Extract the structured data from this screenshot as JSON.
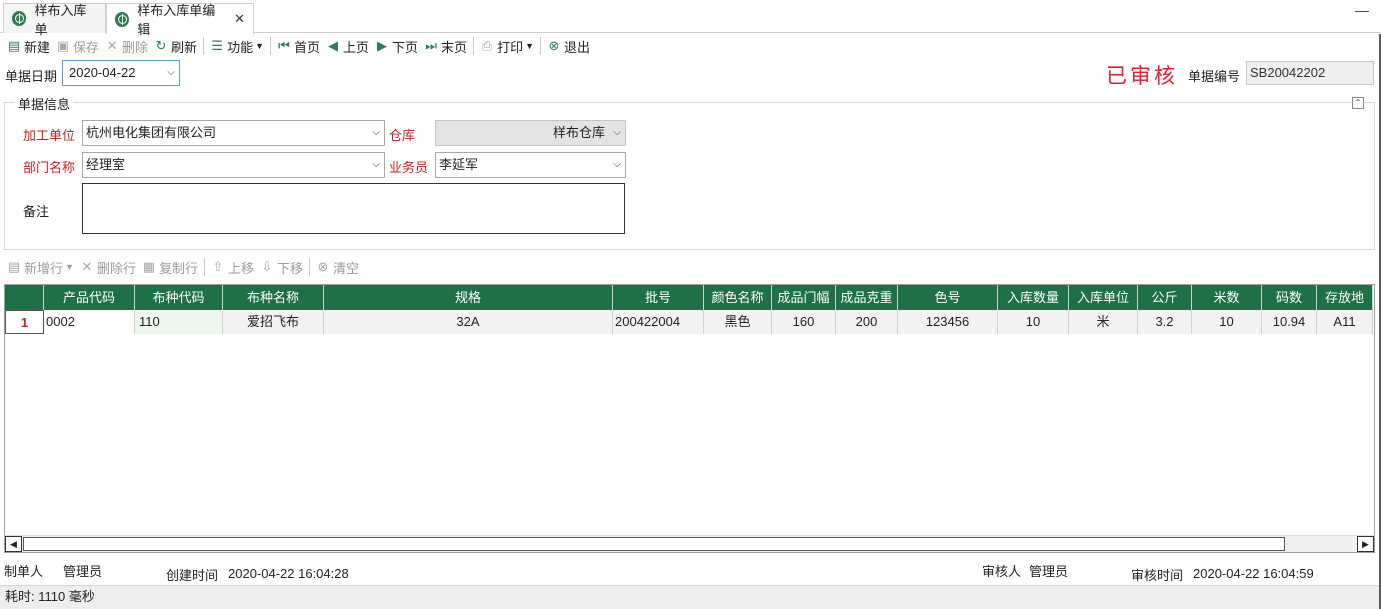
{
  "tabs": [
    {
      "label": "样布入库单"
    },
    {
      "label": "样布入库单编辑"
    }
  ],
  "toolbar": {
    "new": "新建",
    "save": "保存",
    "delete": "删除",
    "refresh": "刷新",
    "function": "功能",
    "first": "首页",
    "prev": "上页",
    "next": "下页",
    "last": "末页",
    "print": "打印",
    "exit": "退出"
  },
  "header": {
    "date_label": "单据日期",
    "date_value": "2020-04-22",
    "status_stamp": "已审核",
    "no_label": "单据编号",
    "no_value": "SB20042202"
  },
  "form": {
    "group_title": "单据信息",
    "processor_label": "加工单位",
    "processor_value": "杭州电化集团有限公司",
    "warehouse_label": "仓库",
    "warehouse_value": "样布仓库",
    "dept_label": "部门名称",
    "dept_value": "经理室",
    "salesman_label": "业务员",
    "salesman_value": "李延军",
    "remark_label": "备注",
    "remark_value": ""
  },
  "grid_toolbar": {
    "add_row": "新增行",
    "delete_row": "删除行",
    "copy_row": "复制行",
    "move_up": "上移",
    "move_down": "下移",
    "clear": "清空"
  },
  "grid": {
    "columns": [
      "",
      "产品代码",
      "布种代码",
      "布种名称",
      "规格",
      "批号",
      "颜色名称",
      "成品门幅",
      "成品克重",
      "色号",
      "入库数量",
      "入库单位",
      "公斤",
      "米数",
      "码数",
      "存放地"
    ],
    "rows": [
      [
        "1",
        "0002",
        "110",
        "爱招飞布",
        "32A",
        "200422004",
        "黑色",
        "160",
        "200",
        "123456",
        "10",
        "米",
        "3.2",
        "10",
        "10.94",
        "A11"
      ]
    ]
  },
  "footer": {
    "creator_label": "制单人",
    "creator_value": "管理员",
    "created_label": "创建时间",
    "created_value": "2020-04-22 16:04:28",
    "auditor_label": "审核人",
    "auditor_value": "管理员",
    "audit_time_label": "审核时间",
    "audit_time_value": "2020-04-22 16:04:59"
  },
  "status": {
    "elapsed": "耗时: 1110 毫秒"
  },
  "colors": {
    "accent": "#1e7145",
    "required_label": "#cc1f1f",
    "stamp": "#e0202a"
  }
}
